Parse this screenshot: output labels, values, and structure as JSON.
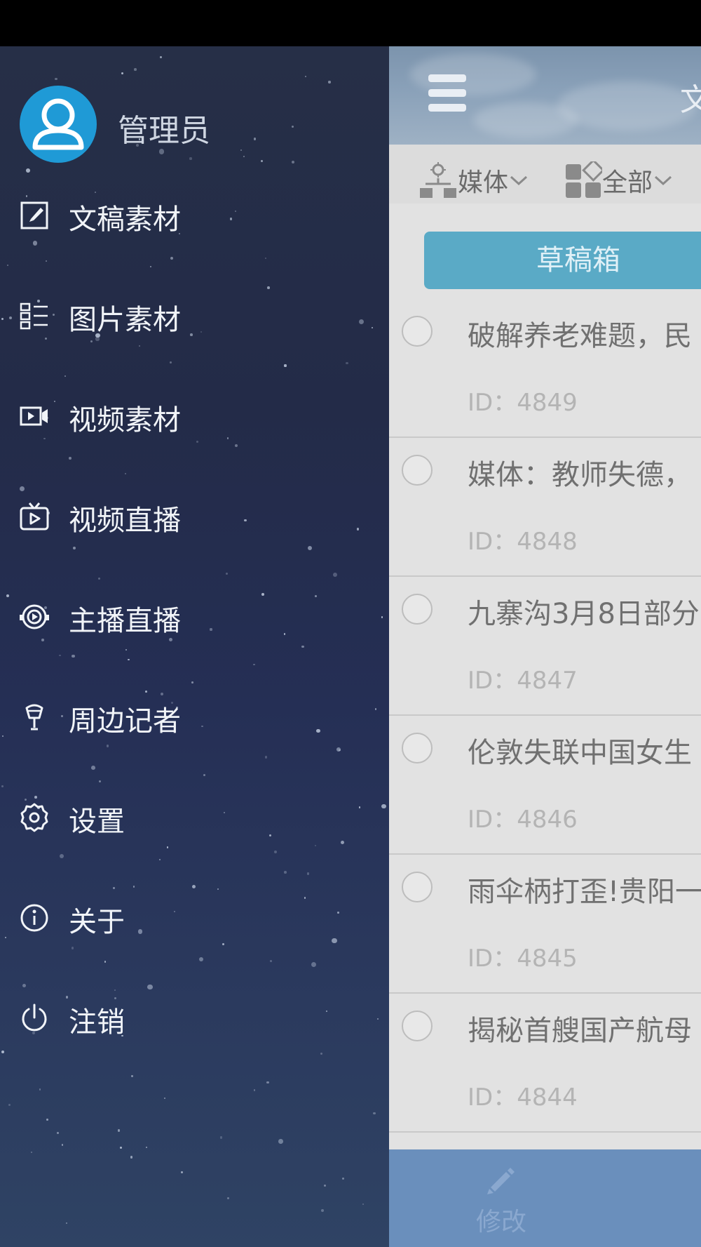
{
  "drawer": {
    "user_name": "管理员",
    "items": [
      {
        "label": "文稿素材",
        "icon": "edit-doc-icon"
      },
      {
        "label": "图片素材",
        "icon": "list-icon"
      },
      {
        "label": "视频素材",
        "icon": "video-camera-icon"
      },
      {
        "label": "视频直播",
        "icon": "tv-play-icon"
      },
      {
        "label": "主播直播",
        "icon": "broadcast-icon"
      },
      {
        "label": "周边记者",
        "icon": "microphone-icon"
      },
      {
        "label": "设置",
        "icon": "gear-icon"
      },
      {
        "label": "关于",
        "icon": "info-icon"
      },
      {
        "label": "注销",
        "icon": "power-icon"
      }
    ]
  },
  "main": {
    "title": "文",
    "filters": {
      "media": "媒体",
      "all": "全部"
    },
    "draft_button": "草稿箱",
    "list": [
      {
        "title": "破解养老难题，民",
        "id": "ID：4849"
      },
      {
        "title": "媒体：教师失德，",
        "id": "ID：4848"
      },
      {
        "title": "九寨沟3月8日部分",
        "id": "ID：4847"
      },
      {
        "title": "伦敦失联中国女生",
        "id": "ID：4846"
      },
      {
        "title": "雨伞柄打歪!贵阳一",
        "id": "ID：4845"
      },
      {
        "title": "揭秘首艘国产航母",
        "id": "ID：4844"
      }
    ],
    "bottom": {
      "edit_label": "修改"
    }
  },
  "colors": {
    "avatar": "#1f9ad6",
    "draft_button": "#5aaac6",
    "bottom_bar": "#6a8fbc",
    "drawer_bg": "#232b48"
  }
}
